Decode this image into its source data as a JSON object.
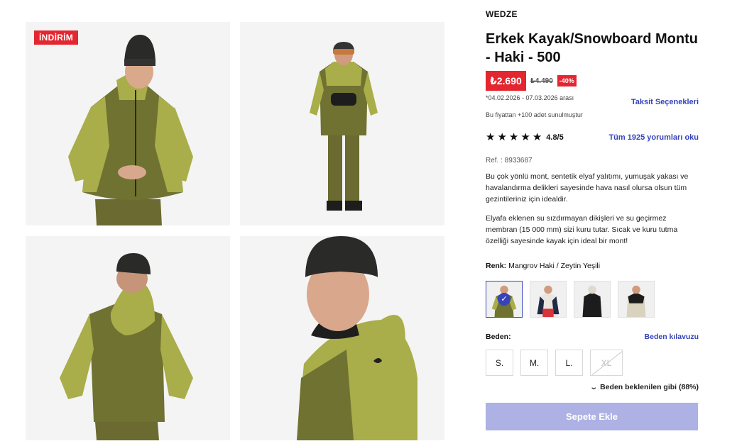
{
  "gallery": {
    "badge": "İNDİRİM",
    "images": [
      "front-view",
      "full-body-view",
      "back-view",
      "side-closeup-view"
    ]
  },
  "product": {
    "brand": "WEDZE",
    "title": "Erkek Kayak/Snowboard Montu - Haki - 500",
    "price": "₺2.690",
    "old_price": "₺4.490",
    "discount": "-40%",
    "date_range": "*04.02.2026 - 07.03.2026 arası",
    "offer_note": "Bu fiyattan +100 adet sunulmuştur",
    "installments_link": "Taksit Seçenekleri",
    "rating": "4.8/5",
    "stars": 5,
    "reviews_link": "Tüm 1925 yorumları oku",
    "ref": "Ref. : 8933687",
    "description_1": "Bu çok yönlü mont, sentetik elyaf yalıtımı, yumuşak yakası ve havalandırma delikleri sayesinde hava nasıl olursa olsun tüm gezintileriniz için idealdir.",
    "description_2": "Elyafa eklenen su sızdırmayan dikişleri ve su geçirmez membran (15 000 mm) sizi kuru tutar. Sıcak ve kuru tutma özelliği sayesinde kayak için ideal bir mont!",
    "color_label": "Renk:",
    "color_value": "Mangrov Haki / Zeytin Yeşili",
    "size_label": "Beden:",
    "size_guide": "Beden kılavuzu",
    "sizes": [
      "S.",
      "M.",
      "L.",
      "XL"
    ],
    "fit_note": "Beden beklenilen gibi (88%)",
    "add_to_cart": "Sepete Ekle"
  },
  "colors": {
    "accent": "#3643ba",
    "sale": "#e3262f",
    "button_disabled": "#aeb1e3",
    "jacket_dark": "#6b6e2a",
    "jacket_light": "#a9ad4a"
  }
}
